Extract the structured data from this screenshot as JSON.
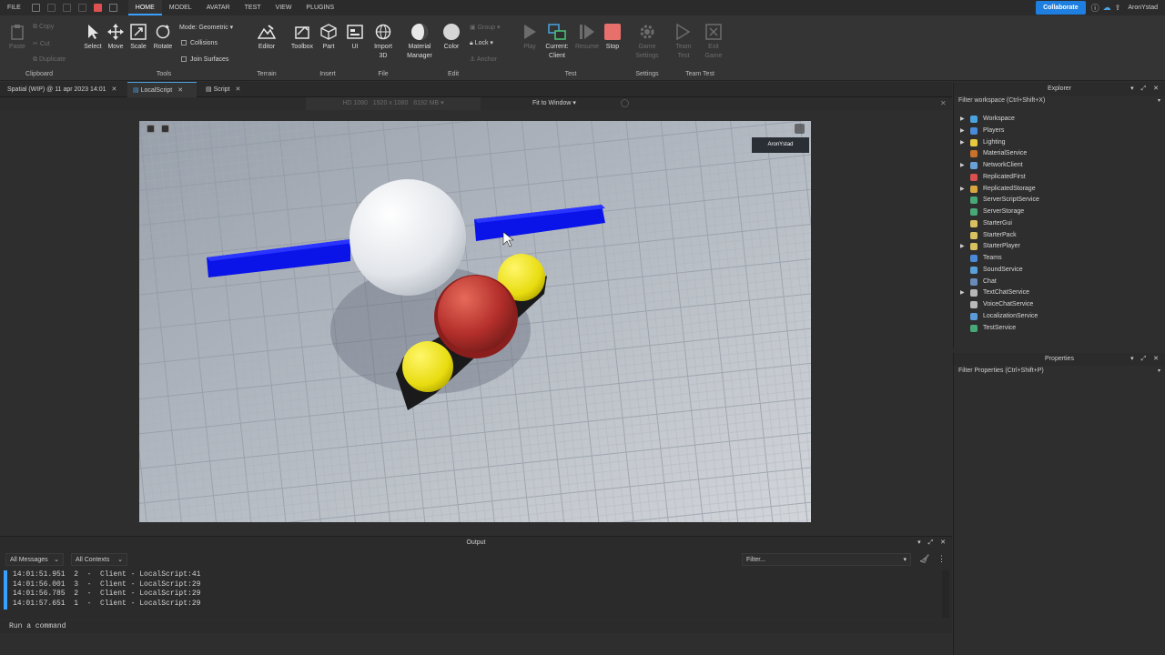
{
  "menubar": {
    "file": "FILE",
    "tabs": [
      "HOME",
      "MODEL",
      "AVATAR",
      "TEST",
      "VIEW",
      "PLUGINS"
    ],
    "collaborate": "Collaborate",
    "username": "AronYstad"
  },
  "ribbon": {
    "clipboard": {
      "paste": "Paste",
      "copy": "Copy",
      "cut": "Cut",
      "duplicate": "Duplicate",
      "group": "Clipboard"
    },
    "tools": {
      "select": "Select",
      "move": "Move",
      "scale": "Scale",
      "rotate": "Rotate",
      "mode_label": "Mode:",
      "mode_value": "Geometric",
      "collisions": "Collisions",
      "join_surfaces": "Join Surfaces",
      "group": "Tools"
    },
    "terrain": {
      "editor": "Editor",
      "group": "Terrain"
    },
    "insert": {
      "toolbox": "Toolbox",
      "part": "Part",
      "ui": "UI",
      "group": "Insert"
    },
    "file": {
      "import": "Import",
      "import2": "3D",
      "group": "File"
    },
    "edit": {
      "material": "Material",
      "material2": "Manager",
      "color": "Color",
      "group_btn": "Group",
      "lock": "Lock",
      "anchor": "Anchor",
      "group": "Edit"
    },
    "test": {
      "play": "Play",
      "current": "Current:",
      "client": "Client",
      "resume": "Resume",
      "stop": "Stop",
      "group": "Test"
    },
    "settings": {
      "game": "Game",
      "game2": "Settings",
      "group": "Settings"
    },
    "teamtest": {
      "team": "Team",
      "team2": "Test",
      "exit": "Exit",
      "exit2": "Game",
      "group": "Team Test"
    }
  },
  "doc_tabs": [
    {
      "label": "Spatial (WIP) @ 11 apr 2023 14:01"
    },
    {
      "label": "LocalScript"
    },
    {
      "label": "Script"
    }
  ],
  "viewport_bar": {
    "device": "HD 1080",
    "resolution": "1920 x 1080",
    "memory": "8192 MB",
    "fit": "Fit to Window"
  },
  "viewport": {
    "player_tag": "AronYstad"
  },
  "output": {
    "title": "Output",
    "messages_filter": "All Messages",
    "contexts_filter": "All Contexts",
    "filter_placeholder": "Filter...",
    "lines": [
      "14:01:51.951  2  -  Client - LocalScript:41",
      "14:01:56.001  3  -  Client - LocalScript:29",
      "14:01:56.785  2  -  Client - LocalScript:29",
      "14:01:57.651  1  -  Client - LocalScript:29"
    ]
  },
  "command_bar": {
    "placeholder": "Run a command"
  },
  "explorer": {
    "title": "Explorer",
    "filter": "Filter workspace (Ctrl+Shift+X)",
    "items": [
      {
        "label": "Workspace",
        "expand": true,
        "color": "#4aa3df"
      },
      {
        "label": "Players",
        "expand": true,
        "color": "#4a8ad8"
      },
      {
        "label": "Lighting",
        "expand": true,
        "color": "#e8c840"
      },
      {
        "label": "MaterialService",
        "expand": false,
        "color": "#c8702c"
      },
      {
        "label": "NetworkClient",
        "expand": true,
        "color": "#6aa0d8"
      },
      {
        "label": "ReplicatedFirst",
        "expand": false,
        "color": "#d95050"
      },
      {
        "label": "ReplicatedStorage",
        "expand": true,
        "color": "#d7a640"
      },
      {
        "label": "ServerScriptService",
        "expand": false,
        "color": "#48a878"
      },
      {
        "label": "ServerStorage",
        "expand": false,
        "color": "#48a878"
      },
      {
        "label": "StarterGui",
        "expand": false,
        "color": "#d9c060"
      },
      {
        "label": "StarterPack",
        "expand": false,
        "color": "#d9c060"
      },
      {
        "label": "StarterPlayer",
        "expand": true,
        "color": "#d9c060"
      },
      {
        "label": "Teams",
        "expand": false,
        "color": "#4a8ad8"
      },
      {
        "label": "SoundService",
        "expand": false,
        "color": "#5aa0d8"
      },
      {
        "label": "Chat",
        "expand": false,
        "color": "#6a8ab8"
      },
      {
        "label": "TextChatService",
        "expand": true,
        "color": "#b8b8b8"
      },
      {
        "label": "VoiceChatService",
        "expand": false,
        "color": "#b8b8b8"
      },
      {
        "label": "LocalizationService",
        "expand": false,
        "color": "#5a9ad8"
      },
      {
        "label": "TestService",
        "expand": false,
        "color": "#48a878"
      }
    ]
  },
  "properties": {
    "title": "Properties",
    "filter": "Filter Properties (Ctrl+Shift+P)"
  }
}
